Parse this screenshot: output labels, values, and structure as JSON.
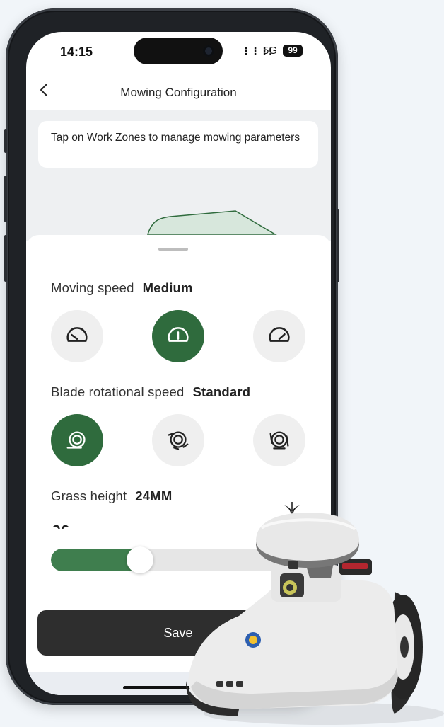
{
  "status_bar": {
    "time": "14:15",
    "network": "5G",
    "battery": "99"
  },
  "header": {
    "title": "Mowing Configuration"
  },
  "tip": {
    "text": "Tap on Work Zones to manage mowing parameters"
  },
  "moving_speed": {
    "label": "Moving speed",
    "value": "Medium",
    "options": [
      {
        "icon": "speed-low-icon",
        "selected": false
      },
      {
        "icon": "speed-medium-icon",
        "selected": true
      },
      {
        "icon": "speed-high-icon",
        "selected": false
      }
    ]
  },
  "blade_speed": {
    "label": "Blade rotational speed",
    "value": "Standard",
    "options": [
      {
        "icon": "blade-standard-icon",
        "selected": true
      },
      {
        "icon": "blade-medium-icon",
        "selected": false
      },
      {
        "icon": "blade-high-icon",
        "selected": false
      }
    ]
  },
  "grass_height": {
    "label": "Grass height",
    "value": "24MM",
    "slider_fraction": 0.35,
    "min_icon": "short-grass-icon",
    "max_icon": "tall-grass-icon"
  },
  "actions": {
    "save_label": "Save"
  },
  "colors": {
    "accent": "#2f6b3d",
    "slider_fill": "#3f7e4e",
    "save_bg": "#2e2e2e"
  }
}
